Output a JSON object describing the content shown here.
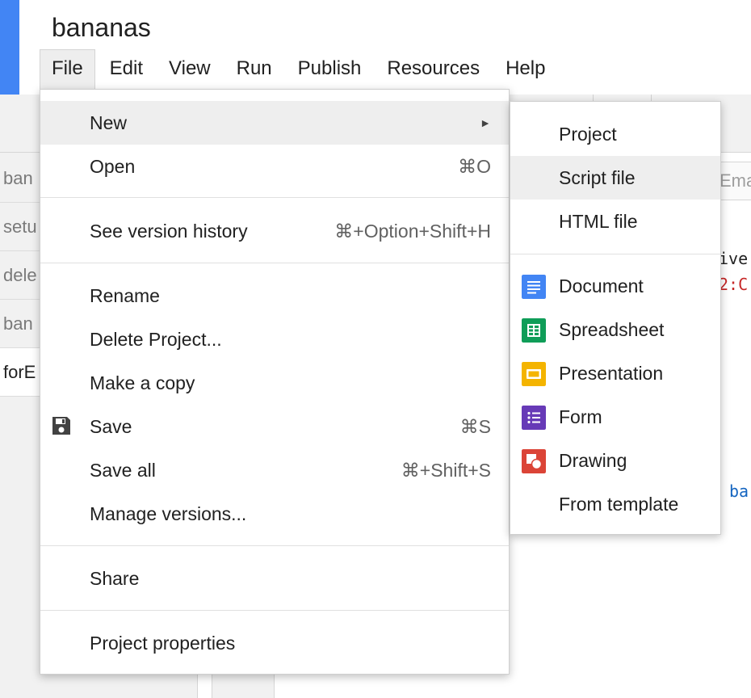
{
  "project": {
    "title": "bananas"
  },
  "menubar": {
    "items": [
      {
        "label": "File",
        "active": true
      },
      {
        "label": "Edit"
      },
      {
        "label": "View"
      },
      {
        "label": "Run"
      },
      {
        "label": "Publish"
      },
      {
        "label": "Resources"
      },
      {
        "label": "Help"
      }
    ]
  },
  "file_list": {
    "items": [
      {
        "label": "ban"
      },
      {
        "label": "setu"
      },
      {
        "label": "dele"
      },
      {
        "label": "ban"
      },
      {
        "label": "forE",
        "selected": true
      }
    ]
  },
  "editor": {
    "tab_label": "Ema",
    "code_fragments": [
      {
        "text": "ive",
        "color": "black"
      },
      {
        "text": "2:C",
        "color": "red"
      },
      {
        "text": "ba",
        "color": "blue"
      }
    ]
  },
  "file_menu": {
    "new": {
      "label": "New",
      "arrow": "►"
    },
    "open": {
      "label": "Open",
      "shortcut": "⌘O"
    },
    "version_history": {
      "label": "See version history",
      "shortcut": "⌘+Option+Shift+H"
    },
    "rename": {
      "label": "Rename"
    },
    "delete": {
      "label": "Delete Project..."
    },
    "copy": {
      "label": "Make a copy"
    },
    "save": {
      "label": "Save",
      "shortcut": "⌘S",
      "icon": "floppy-disk-icon"
    },
    "save_all": {
      "label": "Save all",
      "shortcut": "⌘+Shift+S"
    },
    "manage_versions": {
      "label": "Manage versions..."
    },
    "share": {
      "label": "Share"
    },
    "properties": {
      "label": "Project properties"
    }
  },
  "new_submenu": {
    "project": {
      "label": "Project"
    },
    "script_file": {
      "label": "Script file"
    },
    "html_file": {
      "label": "HTML file"
    },
    "document": {
      "label": "Document",
      "icon": "docs-icon",
      "color": "#4285f4"
    },
    "spreadsheet": {
      "label": "Spreadsheet",
      "icon": "sheets-icon",
      "color": "#0f9d58"
    },
    "presentation": {
      "label": "Presentation",
      "icon": "slides-icon",
      "color": "#f4b400"
    },
    "form": {
      "label": "Form",
      "icon": "forms-icon",
      "color": "#673ab7"
    },
    "drawing": {
      "label": "Drawing",
      "icon": "drawings-icon",
      "color": "#db4437"
    },
    "template": {
      "label": "From template"
    }
  }
}
